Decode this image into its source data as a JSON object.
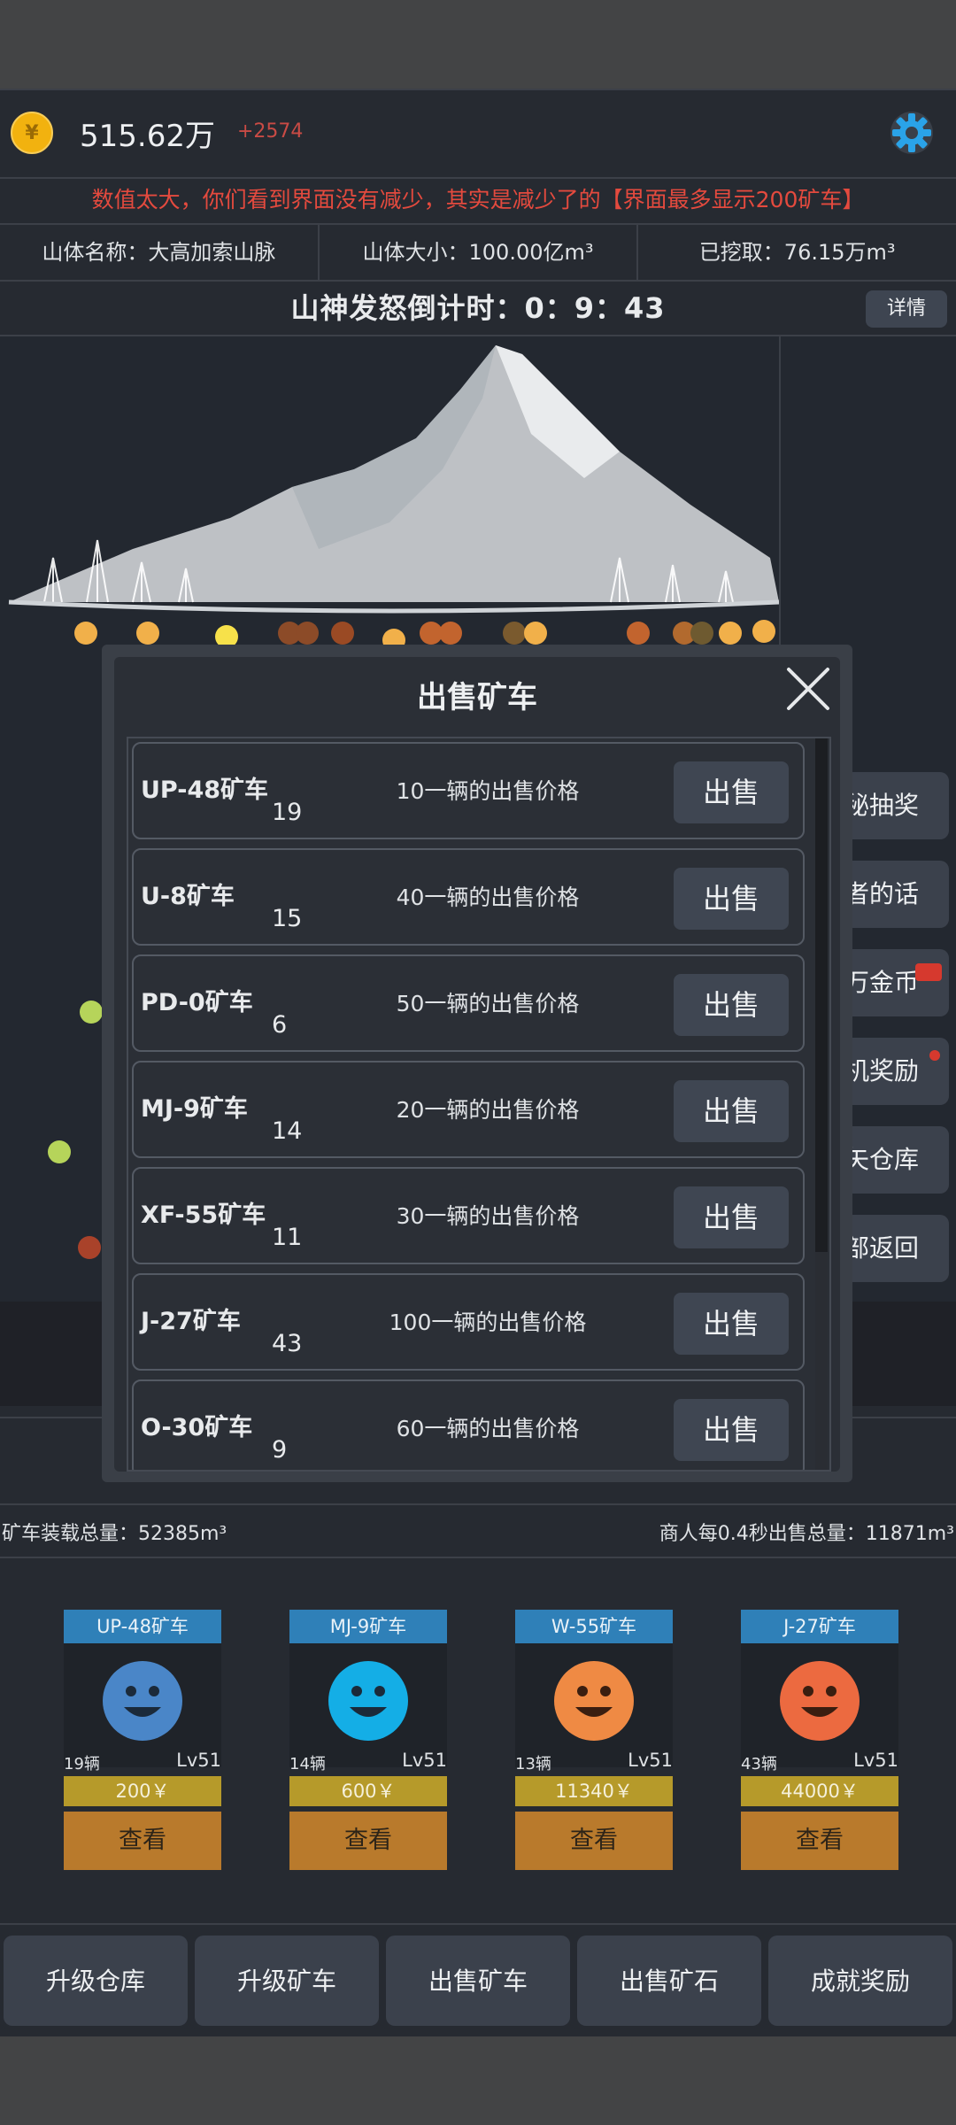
{
  "header": {
    "gold": "515.62万",
    "gold_delta": "+2574",
    "coin_symbol": "¥",
    "coin_icon": "coin-icon",
    "settings_icon": "gear-icon"
  },
  "notice": "数值太大，你们看到界面没有减少，其实是减少了的【界面最多显示200矿车】",
  "mountain_info": {
    "name": "山体名称：大高加索山脉",
    "size": "山体大小：100.00亿m³",
    "dug": "已挖取：76.15万m³"
  },
  "countdown": {
    "label": "山神发怒倒计时：0：9：43",
    "detail_button": "详情"
  },
  "side_buttons": [
    "秘抽奖",
    "者的话",
    "万金币",
    "机奖励",
    "矢仓库",
    "部返回"
  ],
  "totals": {
    "load": "矿车装载总量：52385m³",
    "merchant": "商人每0.4秒出售总量：11871m³"
  },
  "carts": [
    {
      "name": "UP-48矿车",
      "count": "19辆",
      "level": "Lv51",
      "price": "200￥",
      "view": "查看",
      "color": "#4a86c8"
    },
    {
      "name": "MJ-9矿车",
      "count": "14辆",
      "level": "Lv51",
      "price": "600￥",
      "view": "查看",
      "color": "#14aee6"
    },
    {
      "name": "W-55矿车",
      "count": "13辆",
      "level": "Lv51",
      "price": "11340￥",
      "view": "查看",
      "color": "#ef8a44"
    },
    {
      "name": "J-27矿车",
      "count": "43辆",
      "level": "Lv51",
      "price": "44000￥",
      "view": "查看",
      "color": "#ec6a40"
    }
  ],
  "bottom_nav": [
    "升级仓库",
    "升级矿车",
    "出售矿车",
    "出售矿石",
    "成就奖励"
  ],
  "modal": {
    "title": "出售矿车",
    "close_icon": "close-icon",
    "rows": [
      {
        "name": "UP-48矿车",
        "count": "19",
        "price": "10一辆的出售价格",
        "sell": "出售"
      },
      {
        "name": "U-8矿车",
        "count": "15",
        "price": "40一辆的出售价格",
        "sell": "出售"
      },
      {
        "name": "PD-0矿车",
        "count": "6",
        "price": "50一辆的出售价格",
        "sell": "出售"
      },
      {
        "name": "MJ-9矿车",
        "count": "14",
        "price": "20一辆的出售价格",
        "sell": "出售"
      },
      {
        "name": "XF-55矿车",
        "count": "11",
        "price": "30一辆的出售价格",
        "sell": "出售"
      },
      {
        "name": "J-27矿车",
        "count": "43",
        "price": "100一辆的出售价格",
        "sell": "出售"
      },
      {
        "name": "O-30矿车",
        "count": "9",
        "price": "60一辆的出售价格",
        "sell": "出售"
      }
    ]
  }
}
